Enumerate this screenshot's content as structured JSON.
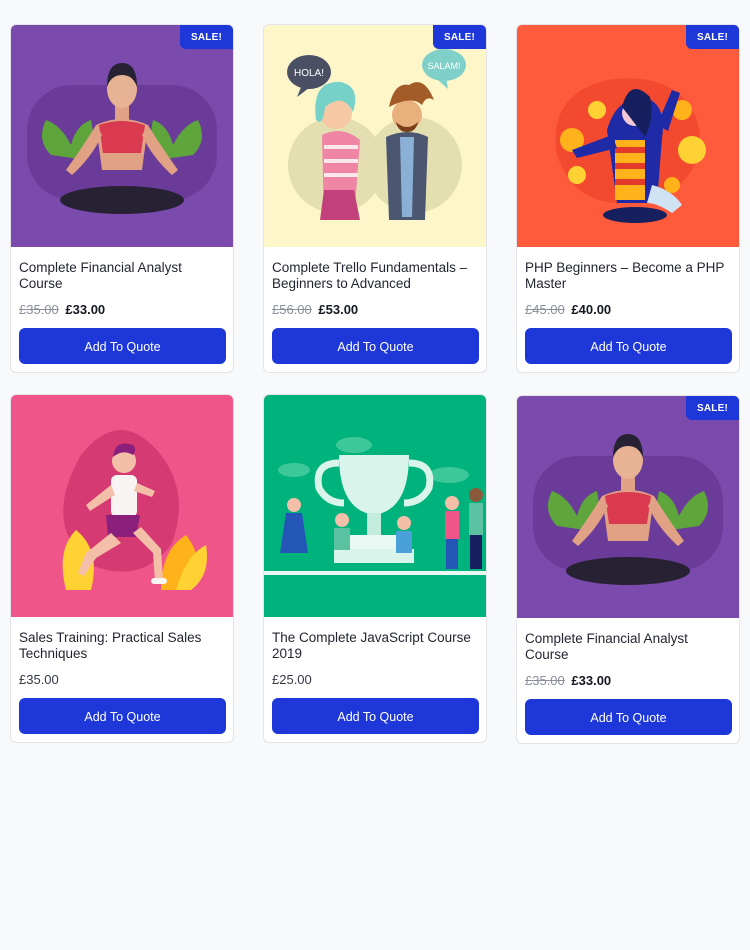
{
  "colors": {
    "accent": "#1d37d8",
    "page_bg": "#f8f9fb"
  },
  "products": [
    {
      "title": "Complete Financial Analyst Course",
      "old_price": "£35.00",
      "price": "£33.00",
      "sale_badge": "SALE!",
      "button": "Add To Quote",
      "image": "yoga-illustration",
      "image_bg": "#7b4aad"
    },
    {
      "title": "Complete Trello Fundamentals – Beginners to Advanced",
      "old_price": "£56.00",
      "price": "£53.00",
      "sale_badge": "SALE!",
      "button": "Add To Quote",
      "image": "conversation-illustration",
      "image_bg": "#fdf6c9",
      "bubble_left": "HOLA!",
      "bubble_right": "SALAM!"
    },
    {
      "title": "PHP Beginners – Become a PHP Master",
      "old_price": "£45.00",
      "price": "£40.00",
      "sale_badge": "SALE!",
      "button": "Add To Quote",
      "image": "celebration-illustration",
      "image_bg": "#fe5a3c"
    },
    {
      "title": "Sales Training: Practical Sales Techniques",
      "price": "£35.00",
      "button": "Add To Quote",
      "image": "runner-illustration",
      "image_bg": "#f0558a"
    },
    {
      "title": "The Complete JavaScript Course 2019",
      "price": "£25.00",
      "button": "Add To Quote",
      "image": "trophy-team-illustration",
      "image_bg": "#00b27c"
    },
    {
      "title": "Complete Financial Analyst Course",
      "old_price": "£35.00",
      "price": "£33.00",
      "sale_badge": "SALE!",
      "button": "Add To Quote",
      "image": "yoga-illustration",
      "image_bg": "#7b4aad"
    }
  ]
}
